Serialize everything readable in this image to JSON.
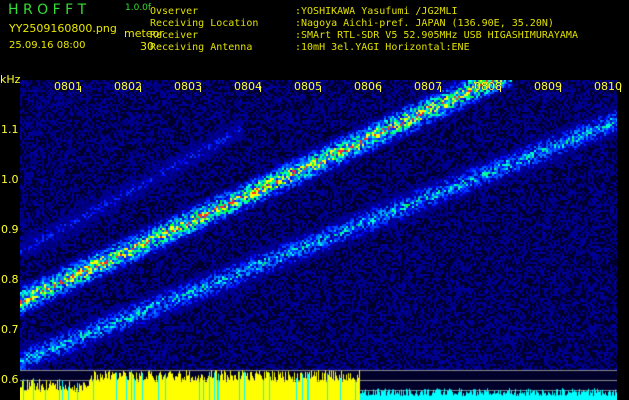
{
  "header": {
    "app_title": "H R O F F T",
    "version": "1.0.0f",
    "filename": "YY2509160800.png",
    "datetime": "25.09.16 08:00",
    "mode_label": "meteor",
    "mode_value": "30"
  },
  "info": [
    {
      "label": "Ovserver",
      "value": ":YOSHIKAWA Yasufumi /JG2MLI"
    },
    {
      "label": "Receiving Location",
      "value": ":Nagoya Aichi-pref. JAPAN (136.90E, 35.20N)"
    },
    {
      "label": "Receiver",
      "value": ":SMArt RTL-SDR V5 52.905MHz USB HIGASHIMURAYAMA"
    },
    {
      "label": "Receiving Antenna",
      "value": ":10mH 3el.YAGI Horizontal:ENE"
    }
  ],
  "axis": {
    "unit": "kHz",
    "time_labels": [
      "0801",
      "0802",
      "0803",
      "0804",
      "0805",
      "0806",
      "0807",
      "0808",
      "0809",
      "0810"
    ],
    "freq_labels": [
      "1.1",
      "1.0",
      "0.9",
      "0.8",
      "0.7",
      "0.6"
    ]
  },
  "colors": {
    "text_yellow": "#e8e800",
    "title_green": "#33dd33",
    "signal_bar": "#ffff00",
    "noise_bar": "#00ffff"
  }
}
